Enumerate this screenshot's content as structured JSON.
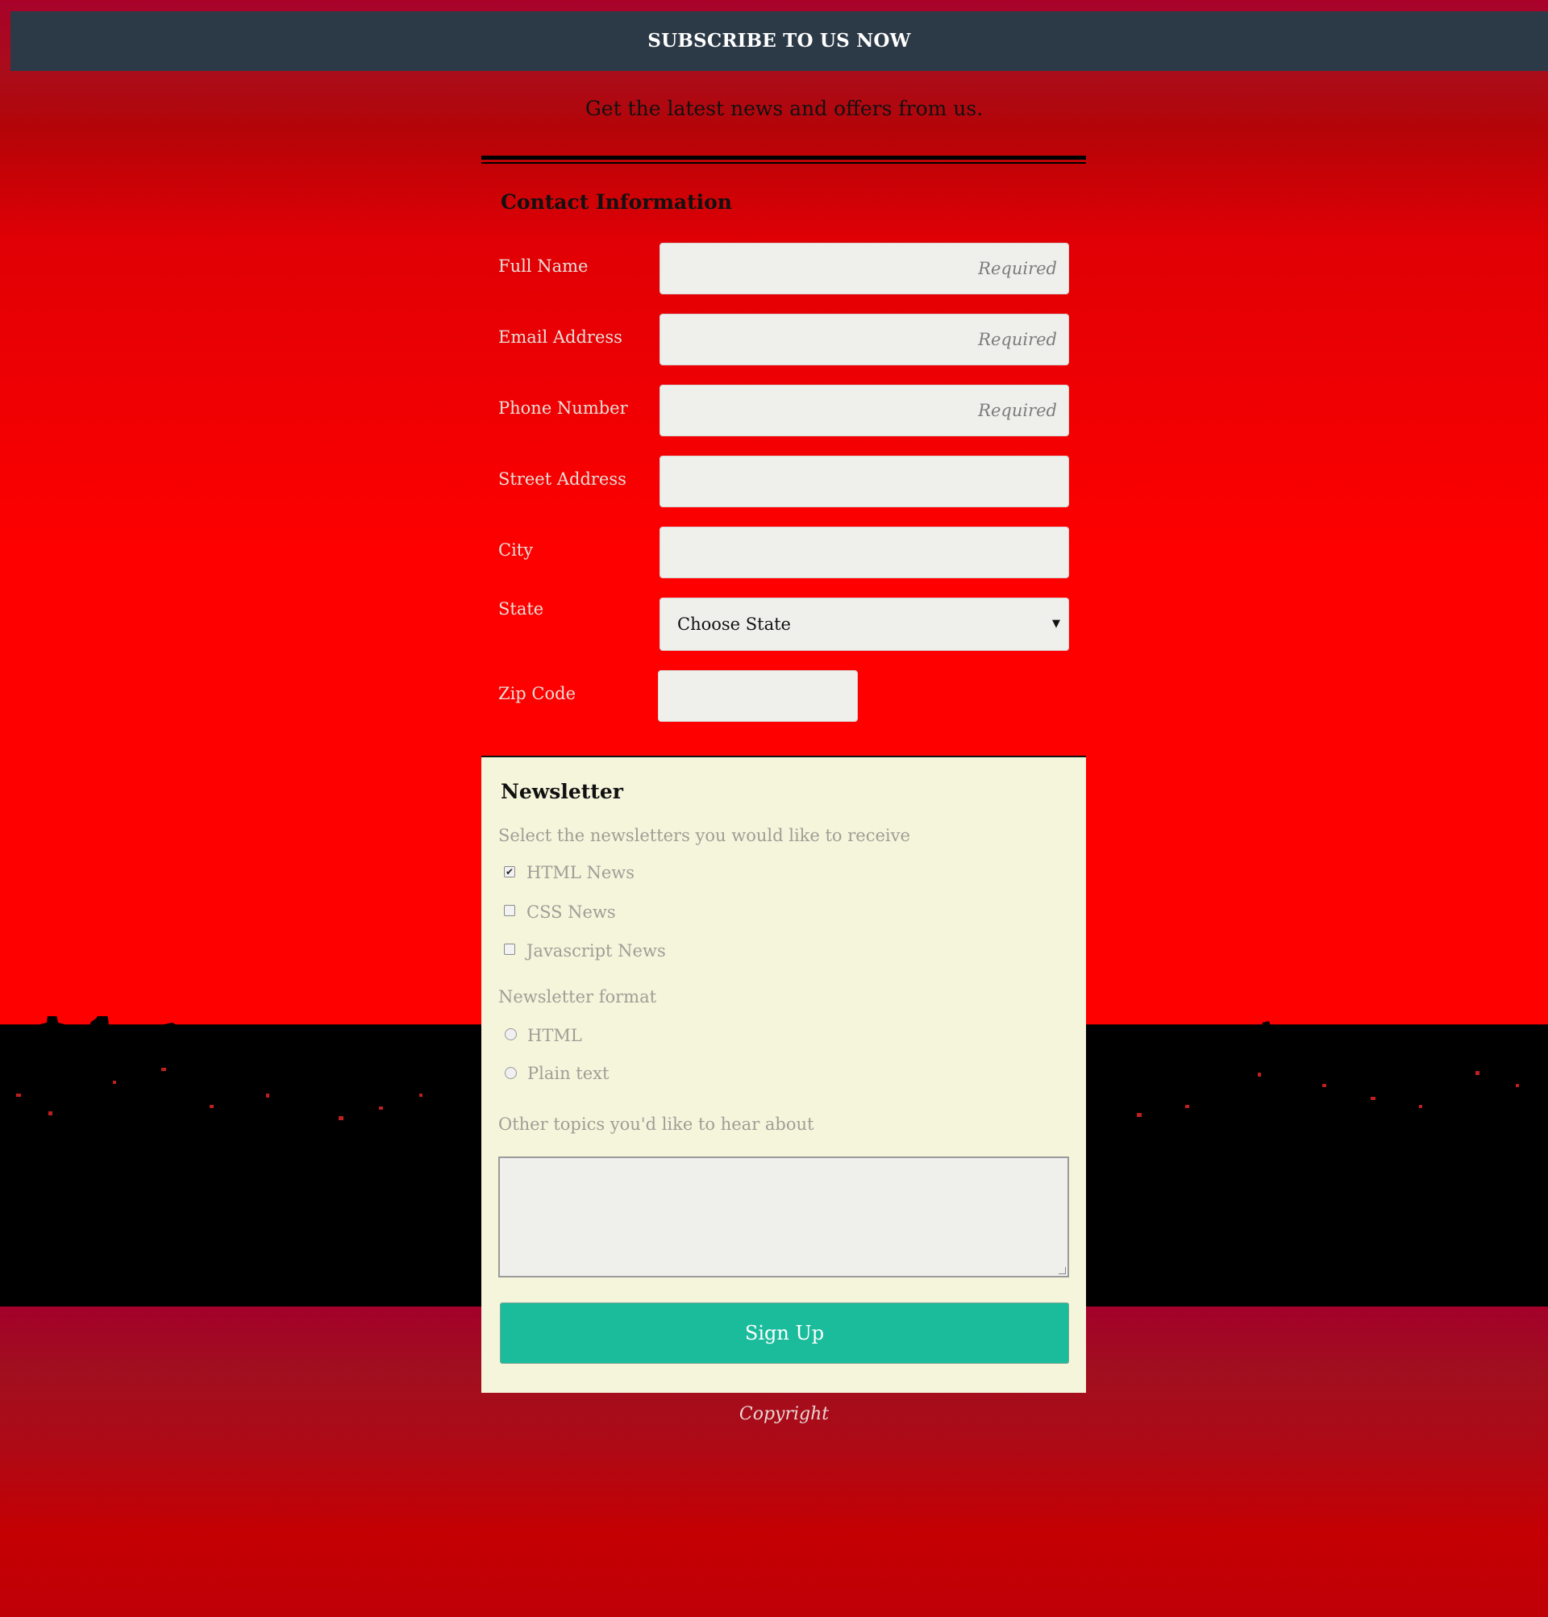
{
  "header": {
    "title": "SUBSCRIBE TO US NOW",
    "tagline": "Get the latest news and offers from us."
  },
  "contact": {
    "legend": "Contact Information",
    "fields": [
      {
        "label": "Full Name",
        "placeholder": "Required",
        "value": ""
      },
      {
        "label": "Email Address",
        "placeholder": "Required",
        "value": ""
      },
      {
        "label": "Phone Number",
        "placeholder": "Required",
        "value": ""
      },
      {
        "label": "Street Address",
        "placeholder": "",
        "value": ""
      },
      {
        "label": "City",
        "placeholder": "",
        "value": ""
      }
    ],
    "state": {
      "label": "State",
      "selected": "Choose State"
    },
    "zip": {
      "label": "Zip Code",
      "value": ""
    }
  },
  "newsletter": {
    "legend": "Newsletter",
    "select_prompt": "Select the newsletters you would like to receive",
    "options": [
      {
        "label": "HTML News",
        "checked": true
      },
      {
        "label": "CSS News",
        "checked": false
      },
      {
        "label": "Javascript News",
        "checked": false
      }
    ],
    "format_prompt": "Newsletter format",
    "formats": [
      {
        "label": "HTML",
        "selected": false
      },
      {
        "label": "Plain text",
        "selected": false
      }
    ],
    "topics_prompt": "Other topics you'd like to hear about",
    "topics_value": "",
    "submit_label": "Sign Up"
  },
  "footer": {
    "copyright": "Copyright"
  },
  "colors": {
    "topbar": "#2c3a47",
    "background_red": "#ff0000",
    "panel": "#f5f5dc",
    "button": "#1abc9c"
  }
}
